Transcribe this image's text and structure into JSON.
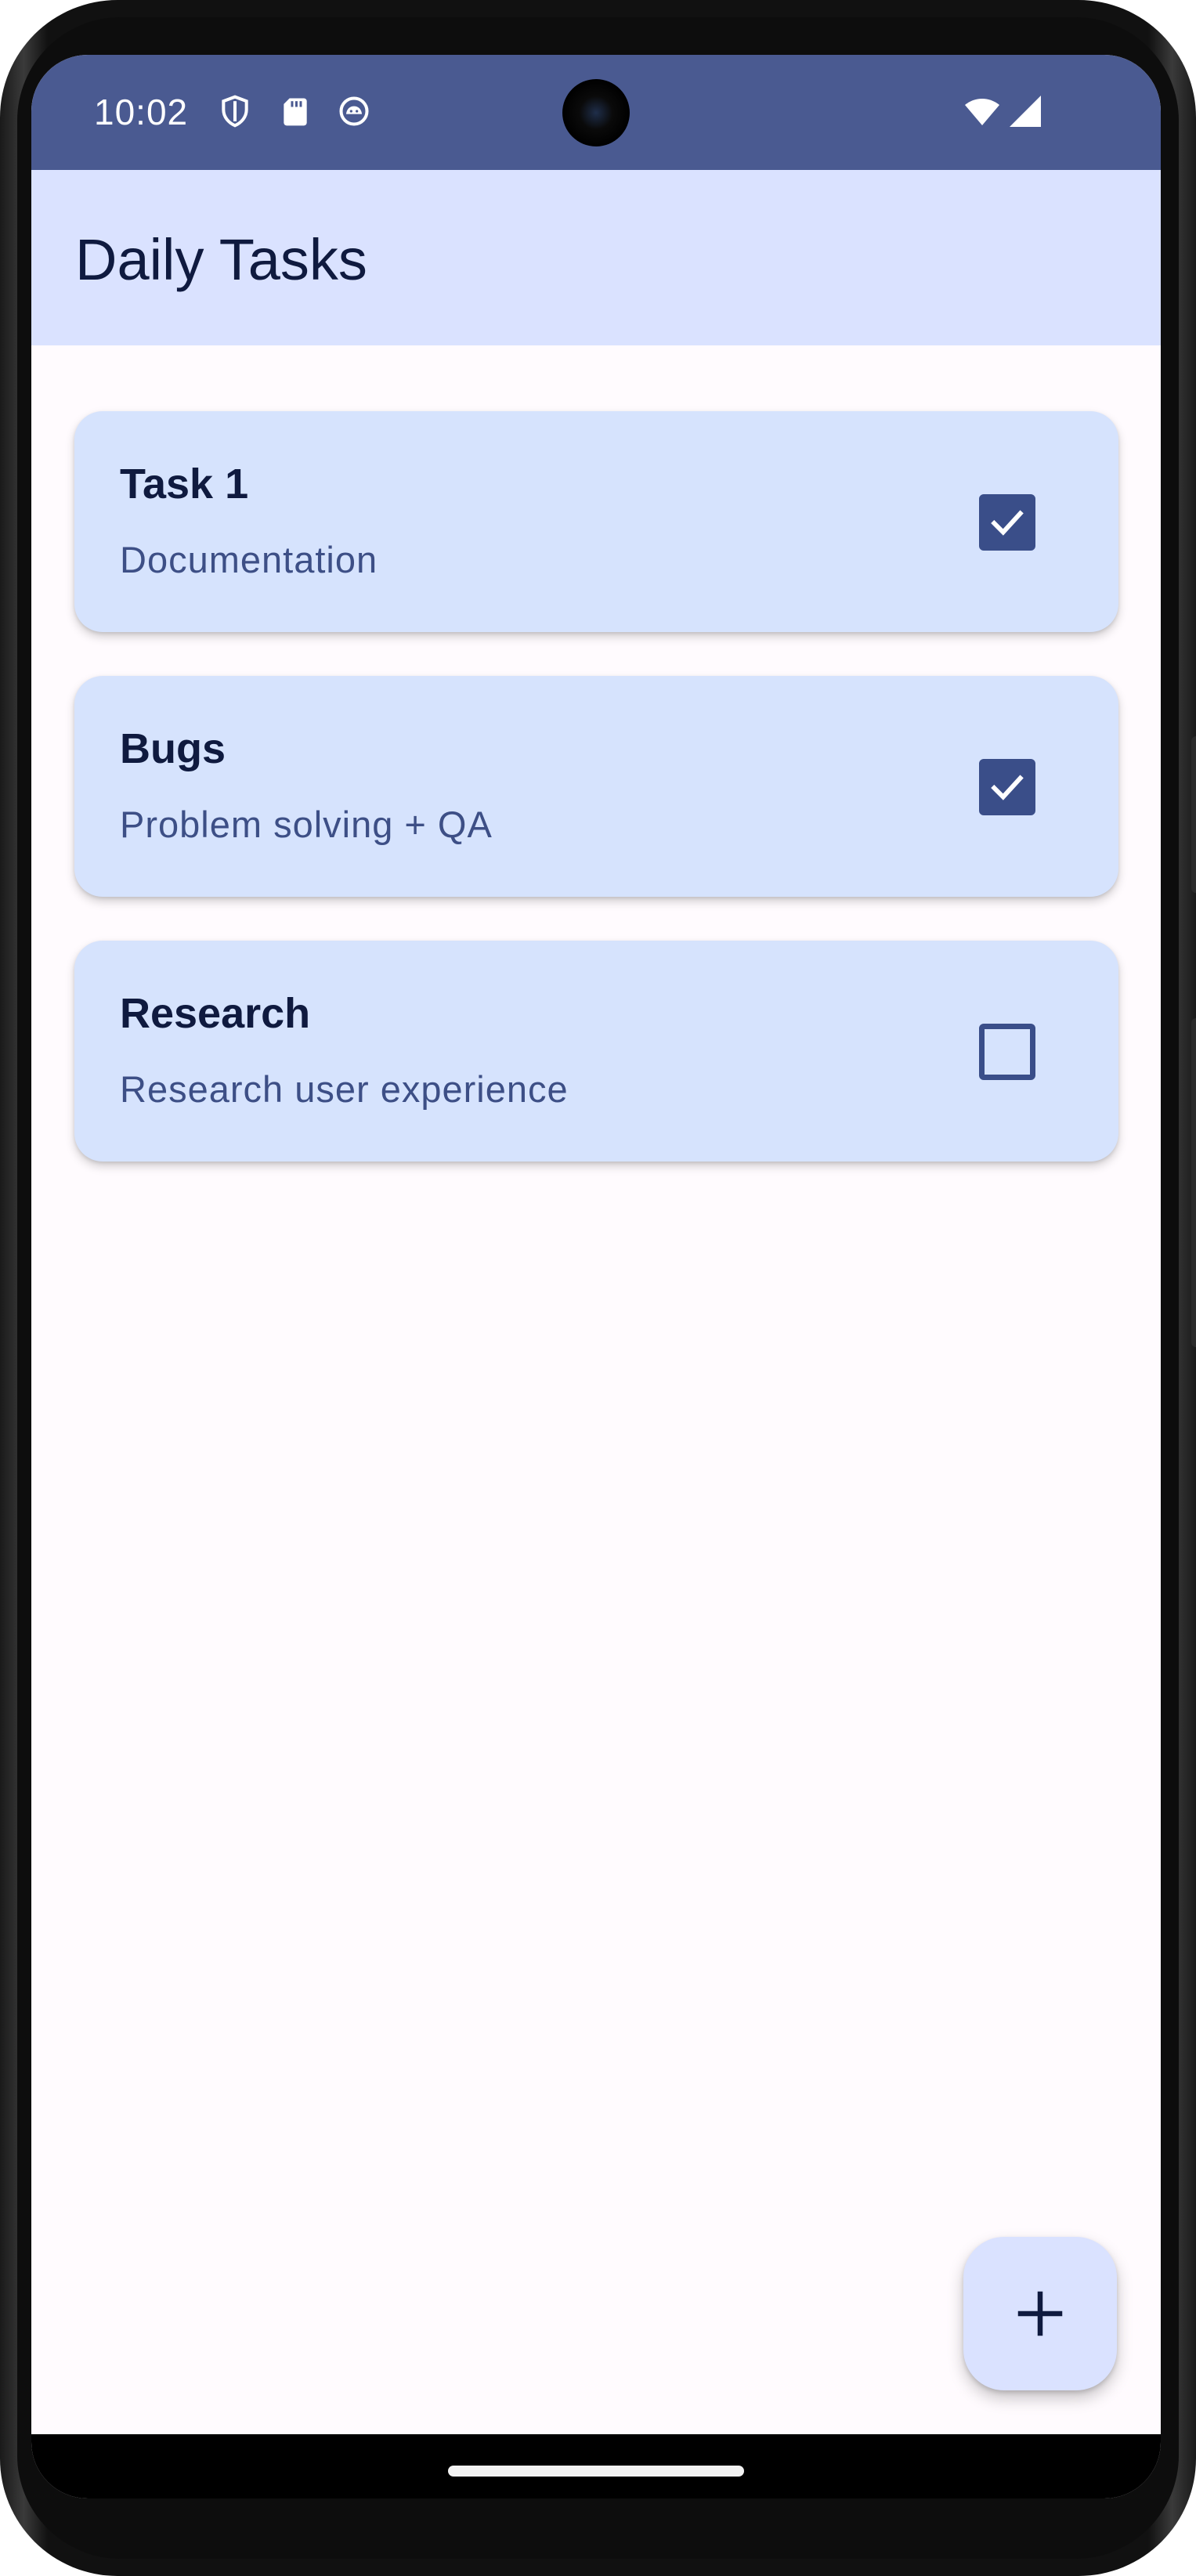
{
  "status_bar": {
    "time": "10:02",
    "icons": [
      "shield-icon",
      "sd-card-icon",
      "android-debug-icon",
      "wifi-icon",
      "cellular-signal-icon"
    ]
  },
  "app_bar": {
    "title": "Daily Tasks"
  },
  "tasks": [
    {
      "title": "Task 1",
      "subtitle": "Documentation",
      "checked": true
    },
    {
      "title": "Bugs",
      "subtitle": "Problem solving + QA",
      "checked": true
    },
    {
      "title": "Research",
      "subtitle": "Research user experience",
      "checked": false
    }
  ],
  "fab": {
    "icon": "plus-icon"
  },
  "colors": {
    "status_bar": "#4a5a91",
    "app_bar": "#dae2ff",
    "card": "#d6e3fd",
    "checkbox": "#3a4e89",
    "title_text": "#0f1a3f",
    "subtitle_text": "#3d4f86",
    "background": "#fffbfe"
  }
}
